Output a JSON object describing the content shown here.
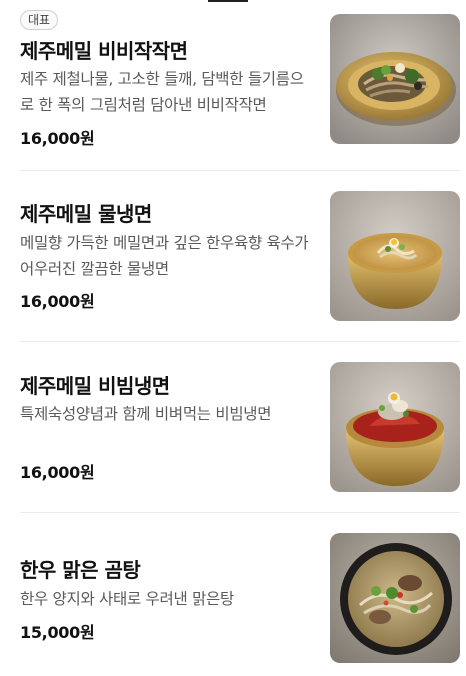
{
  "menu": {
    "items": [
      {
        "badge": "대표",
        "name": "제주메밀 비비작작면",
        "description": "제주 제철나물, 고소한 들깨, 담백한 들기름으로 한 폭의 그림처럼 담아낸 비비작작면",
        "price": "16,000원",
        "image_icon": "bibim-noodle-photo"
      },
      {
        "name": "제주메밀 물냉면",
        "description": "메밀향 가득한 메밀면과 깊은 한우육향 육수가 어우러진 깔끔한 물냉면",
        "price": "16,000원",
        "image_icon": "cold-noodle-soup-photo"
      },
      {
        "name": "제주메밀 비빔냉면",
        "description": "특제숙성양념과 함께 비벼먹는 비빔냉면",
        "price": "16,000원",
        "image_icon": "spicy-cold-noodle-photo"
      },
      {
        "name": "한우 맑은 곰탕",
        "description": "한우 양지와 사태로 우려낸 맑은탕",
        "price": "15,000원",
        "image_icon": "beef-bone-soup-photo"
      }
    ]
  }
}
